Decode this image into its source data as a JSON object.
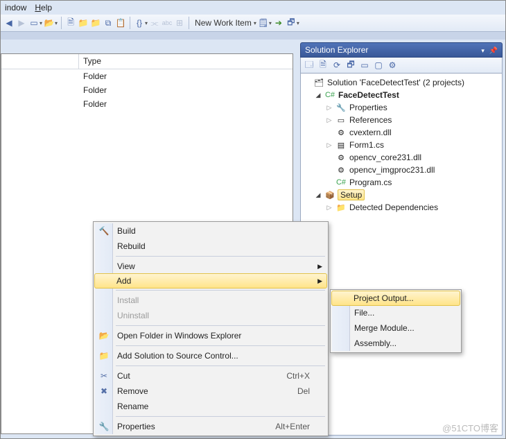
{
  "menus": {
    "window": "indow",
    "help": "Help"
  },
  "toolbar2": {
    "newWorkItem": "New Work Item"
  },
  "leftPane": {
    "headerType": "Type",
    "rows": [
      "Folder",
      "Folder",
      "Folder"
    ]
  },
  "solutionExplorer": {
    "title": "Solution Explorer",
    "solutionLabel": "Solution 'FaceDetectTest' (2 projects)",
    "project": "FaceDetectTest",
    "items": {
      "properties": "Properties",
      "references": "References",
      "cvextern": "cvextern.dll",
      "form1": "Form1.cs",
      "opencvcore": "opencv_core231.dll",
      "opencvimgproc": "opencv_imgproc231.dll",
      "program": "Program.cs",
      "setup": "Setup",
      "detected": "Detected Dependencies"
    }
  },
  "ctx": {
    "build": "Build",
    "rebuild": "Rebuild",
    "view": "View",
    "add": "Add",
    "install": "Install",
    "uninstall": "Uninstall",
    "openFolder": "Open Folder in Windows Explorer",
    "addSource": "Add Solution to Source Control...",
    "cut": "Cut",
    "cut_sc": "Ctrl+X",
    "remove": "Remove",
    "remove_sc": "Del",
    "rename": "Rename",
    "properties": "Properties",
    "properties_sc": "Alt+Enter"
  },
  "sub": {
    "projectOutput": "Project Output...",
    "file": "File...",
    "mergeModule": "Merge Module...",
    "assembly": "Assembly..."
  },
  "watermark": "@51CTO博客"
}
